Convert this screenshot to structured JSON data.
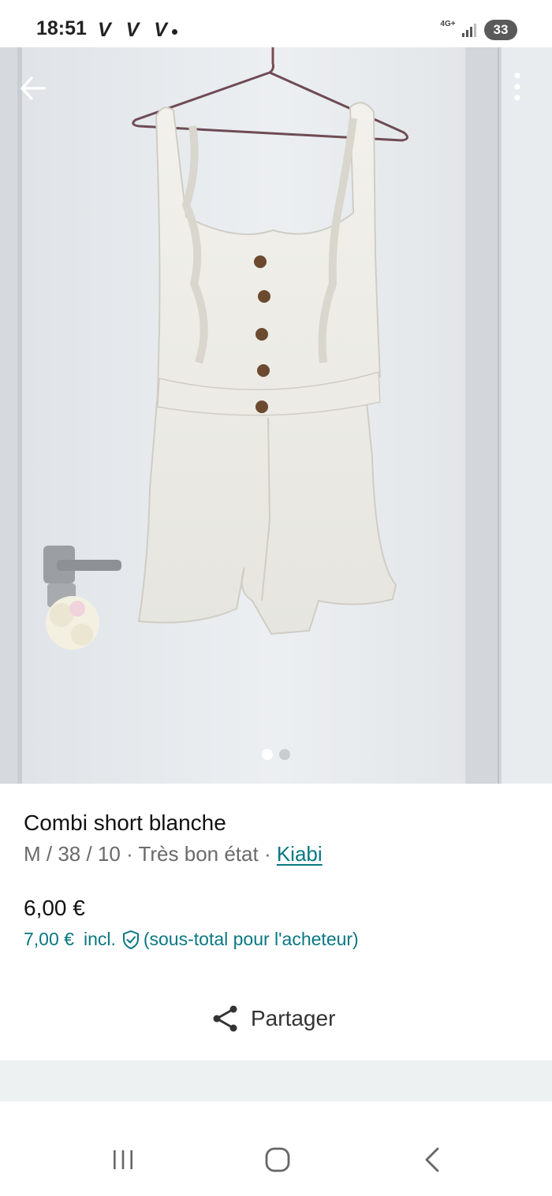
{
  "status_bar": {
    "time": "18:51",
    "notification_icons": "V V V",
    "network": "4G+",
    "battery": "33"
  },
  "photo": {
    "icons": [
      "back-arrow-icon",
      "more-vertical-icon"
    ],
    "page_count": 2,
    "active_page": 1
  },
  "item": {
    "title": "Combi short blanche",
    "size": "M / 38 / 10",
    "separator": " · ",
    "condition": "Très bon état",
    "brand": "Kiabi",
    "price": "6,00 €",
    "buyer_price": "7,00 €",
    "buyer_incl": "incl.",
    "buyer_note": "(sous-total pour l'acheteur)"
  },
  "share": {
    "label": "Partager",
    "icon": "share-icon"
  },
  "nav_bar": {
    "icons": [
      "recent-apps-icon",
      "home-icon",
      "back-icon"
    ]
  },
  "colors": {
    "accent": "#097782",
    "text": "#111111",
    "muted": "#6a6a6a",
    "band": "#eef1f1"
  }
}
